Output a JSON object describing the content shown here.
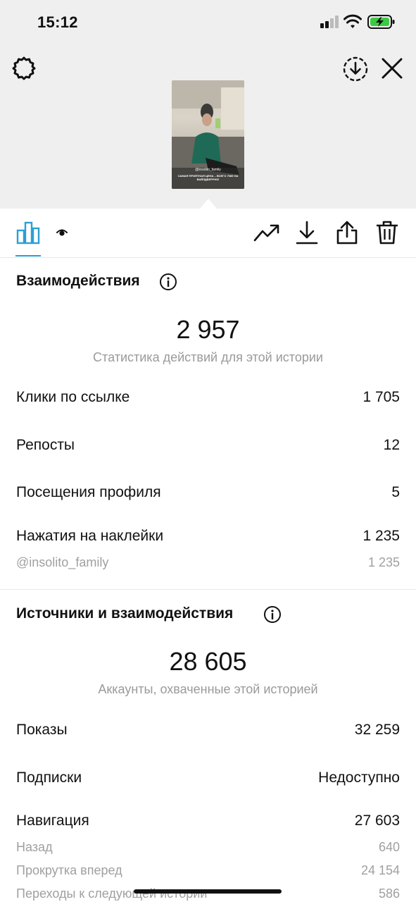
{
  "status_bar": {
    "time": "15:12"
  },
  "story_preview": {
    "username": "@insolito_family",
    "caption": "САМАЯ ПРИЯТНАЯ ЦЕНА – ВСЕГО 7089 НА ВАЙЛДБЕРРИЗ!"
  },
  "interactions": {
    "title": "Взаимодействия",
    "total": "2 957",
    "caption": "Статистика действий для этой истории",
    "rows": [
      {
        "label": "Клики по ссылке",
        "value": "1 705"
      },
      {
        "label": "Репосты",
        "value": "12"
      },
      {
        "label": "Посещения профиля",
        "value": "5"
      },
      {
        "label": "Нажатия на наклейки",
        "value": "1 235"
      }
    ],
    "sub_rows": [
      {
        "label": "@insolito_family",
        "value": "1 235"
      }
    ]
  },
  "discovery": {
    "title": "Источники и взаимодействия",
    "total": "28 605",
    "caption": "Аккаунты, охваченные этой историей",
    "rows": [
      {
        "label": "Показы",
        "value": "32 259"
      },
      {
        "label": "Подписки",
        "value": "Недоступно"
      },
      {
        "label": "Навигация",
        "value": "27 603"
      }
    ],
    "sub_rows": [
      {
        "label": "Назад",
        "value": "640"
      },
      {
        "label": "Прокрутка вперед",
        "value": "24 154"
      },
      {
        "label": "Переходы к следующей истории",
        "value": "586"
      }
    ]
  },
  "colors": {
    "accent": "#2a9fd8",
    "muted": "#9a9a9a",
    "top_bg": "#efefef"
  },
  "icons": [
    "gear-icon",
    "download-circle-icon",
    "close-icon",
    "bar-chart-icon",
    "eye-icon",
    "trending-icon",
    "download-icon",
    "share-icon",
    "trash-icon",
    "info-icon"
  ]
}
